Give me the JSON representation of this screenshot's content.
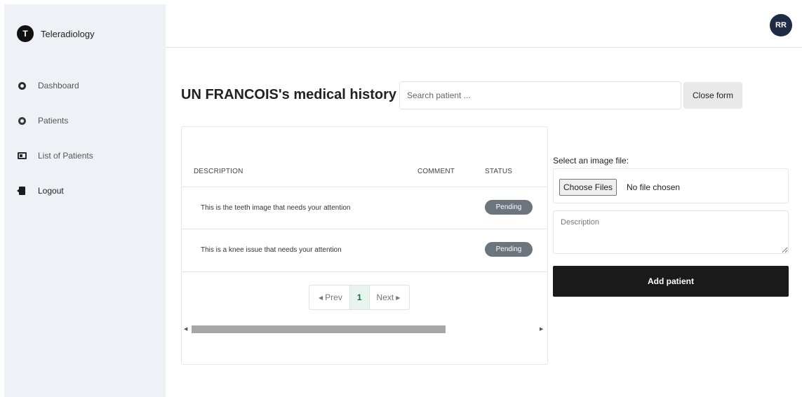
{
  "app": {
    "logo_letter": "T",
    "name": "Teleradiology"
  },
  "sidebar": {
    "items": [
      {
        "label": "Dashboard",
        "icon": "circle-dot-icon"
      },
      {
        "label": "Patients",
        "icon": "users-icon"
      },
      {
        "label": "List of Patients",
        "icon": "id-card-icon"
      }
    ],
    "logout": {
      "label": "Logout",
      "icon": "logout-door-icon"
    }
  },
  "header": {
    "avatar_initials": "RR"
  },
  "main": {
    "title": "UN FRANCOIS's medical history",
    "search_placeholder": "Search patient ...",
    "close_form_label": "Close form"
  },
  "table": {
    "columns": [
      "DESCRIPTION",
      "COMMENT",
      "STATUS"
    ],
    "rows": [
      {
        "description": "This is the teeth image that needs your attention",
        "comment": "",
        "status": "Pending"
      },
      {
        "description": "This is a knee issue that needs your attention",
        "comment": "",
        "status": "Pending"
      }
    ],
    "pagination": {
      "prev": "Prev",
      "current": "1",
      "next": "Next"
    }
  },
  "form": {
    "file_label": "Select an image file:",
    "choose_files": "Choose Files",
    "file_status": "No file chosen",
    "description_placeholder": "Description",
    "submit_label": "Add patient"
  },
  "colors": {
    "primary_button": "#1a1a1a",
    "badge_pending": "#6c757d",
    "sidebar_bg": "#eef1f5",
    "avatar_bg": "#1f2a44"
  }
}
